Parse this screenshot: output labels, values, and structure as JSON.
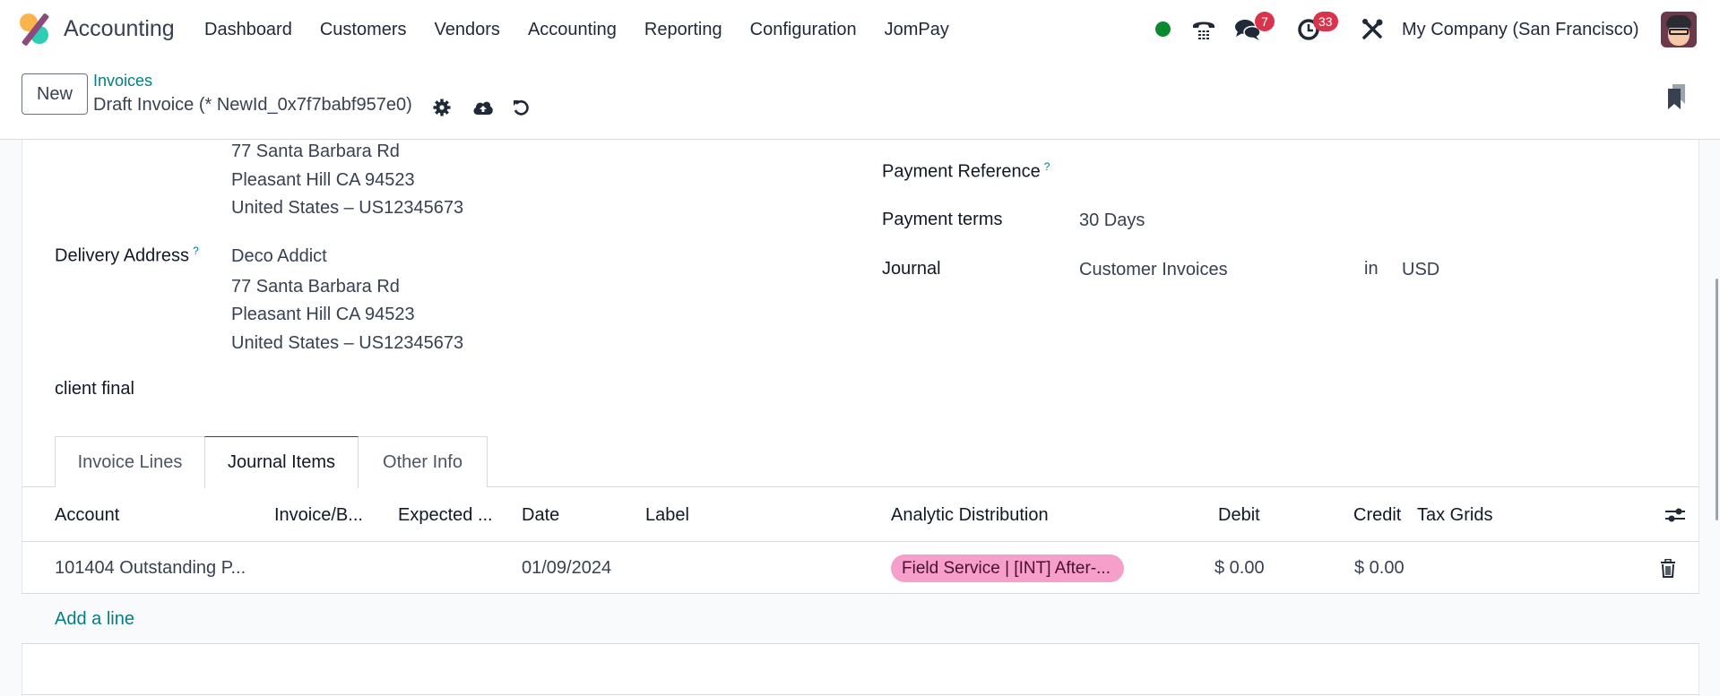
{
  "navbar": {
    "app_name": "Accounting",
    "menu": [
      "Dashboard",
      "Customers",
      "Vendors",
      "Accounting",
      "Reporting",
      "Configuration",
      "JomPay"
    ],
    "status_color": "#0a8a2e",
    "messages_badge": "7",
    "activities_badge": "33",
    "badge_color": "#d9344b",
    "company": "My Company (San Francisco)",
    "icons": [
      "presence-dot",
      "phone-icon",
      "chat-icon",
      "clock-icon",
      "tools-icon",
      "avatar"
    ]
  },
  "control_panel": {
    "new_label": "New",
    "breadcrumb": "Invoices",
    "record_title": "Draft Invoice (* NewId_0x7f7babf957e0)",
    "icons": [
      "gear-icon",
      "cloud-upload-icon",
      "undo-icon",
      "bookmark-icon"
    ]
  },
  "form": {
    "invoice_address_lines": [
      "77 Santa Barbara Rd",
      "Pleasant Hill CA 94523",
      "United States – US12345673"
    ],
    "delivery_address": {
      "label": "Delivery Address",
      "help": "?",
      "lines": [
        "Deco Addict",
        "77 Santa Barbara Rd",
        "Pleasant Hill CA 94523",
        "United States – US12345673"
      ]
    },
    "note": "client final",
    "payment_reference": {
      "label": "Payment Reference",
      "help": "?",
      "value": ""
    },
    "payment_terms": {
      "label": "Payment terms",
      "value": "30 Days"
    },
    "journal": {
      "label": "Journal",
      "value": "Customer Invoices",
      "in_label": "in",
      "currency": "USD"
    }
  },
  "tabs": [
    {
      "label": "Invoice Lines",
      "active": false
    },
    {
      "label": "Journal Items",
      "active": true
    },
    {
      "label": "Other Info",
      "active": false
    }
  ],
  "journal_items": {
    "columns": [
      "Account",
      "Invoice/B...",
      "Expected ...",
      "Date",
      "Label",
      "Analytic Distribution",
      "Debit",
      "Credit",
      "Tax Grids"
    ],
    "rows": [
      {
        "account": "101404 Outstanding P...",
        "invoice_bill": "",
        "expected": "",
        "date": "01/09/2024",
        "label": "",
        "analytic_distribution": "Field Service | [INT] After-...",
        "analytic_tag_color": "#f79fcb",
        "debit": "$ 0.00",
        "credit": "$ 0.00",
        "tax_grids": ""
      }
    ],
    "add_line_label": "Add a line"
  }
}
